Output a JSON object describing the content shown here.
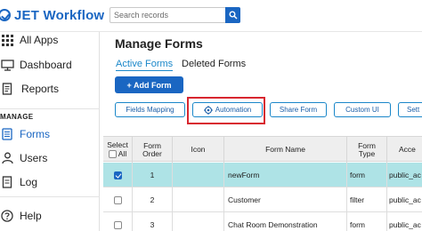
{
  "app": {
    "title": "JET Workflow"
  },
  "search": {
    "placeholder": "Search records"
  },
  "sidebar": {
    "items": [
      {
        "label": "All Apps",
        "icon": "grid-icon"
      },
      {
        "label": "Dashboard",
        "icon": "monitor-icon"
      },
      {
        "label": "Reports",
        "icon": "document-icon"
      }
    ],
    "section_title": "MANAGE",
    "manage_items": [
      {
        "label": "Forms",
        "icon": "forms-icon",
        "active": true
      },
      {
        "label": "Users",
        "icon": "user-icon"
      },
      {
        "label": "Log",
        "icon": "log-icon"
      }
    ],
    "help": {
      "label": "Help",
      "icon": "help-icon"
    }
  },
  "main": {
    "title": "Manage Forms",
    "tabs": [
      {
        "label": "Active Forms",
        "active": true
      },
      {
        "label": "Deleted Forms",
        "active": false
      }
    ],
    "add_button": "+ Add Form",
    "toolbar": [
      "Fields Mapping",
      "Automation",
      "Share Form",
      "Custom UI",
      "Sett"
    ]
  },
  "table": {
    "columns": [
      "Select All",
      "Form Order",
      "Icon",
      "Form Name",
      "Form Type",
      "Acce"
    ],
    "rows": [
      {
        "selected": true,
        "order": "1",
        "name": "newForm",
        "type": "form",
        "access": "public_ac"
      },
      {
        "selected": false,
        "order": "2",
        "name": "Customer",
        "type": "filter",
        "access": "public_ac"
      },
      {
        "selected": false,
        "order": "3",
        "name": "Chat Room Demonstration",
        "type": "form",
        "access": "public_ac"
      }
    ]
  },
  "colors": {
    "brand": "#1a66c2",
    "link": "#1a87c9",
    "selected_row": "#aee3e6",
    "highlight": "#d8262f"
  }
}
